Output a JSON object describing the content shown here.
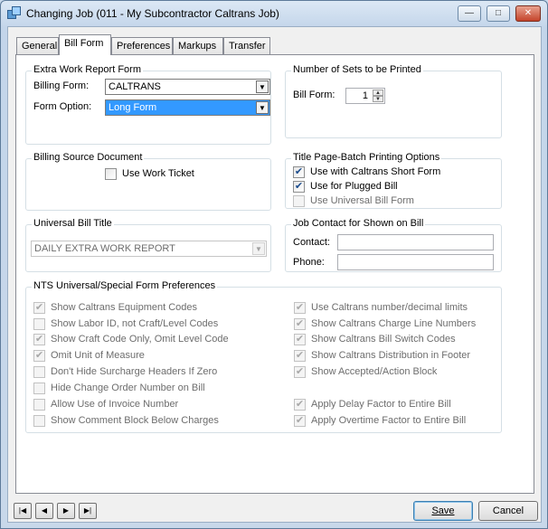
{
  "window": {
    "title": "Changing Job  (011 - My Subcontractor Caltrans Job)",
    "controls": {
      "minimize": "—",
      "maximize": "□",
      "close": "✕"
    }
  },
  "tabs": [
    {
      "label": "General"
    },
    {
      "label": "Bill Form",
      "active": true
    },
    {
      "label": "Preferences"
    },
    {
      "label": "Markups"
    },
    {
      "label": "Transfer"
    }
  ],
  "extra_work": {
    "title": "Extra Work Report Form",
    "billing_form_label": "Billing Form:",
    "billing_form_value": "CALTRANS",
    "form_option_label": "Form Option:",
    "form_option_value": "Long Form"
  },
  "sets_printed": {
    "title": "Number of Sets to be Printed",
    "bill_form_label": "Bill Form:",
    "bill_form_value": "1"
  },
  "billing_source": {
    "title": "Billing Source Document",
    "use_work_ticket": {
      "label": "Use Work Ticket",
      "checked": false
    }
  },
  "title_page": {
    "title": "Title Page-Batch Printing Options",
    "options": [
      {
        "label": "Use with Caltrans Short Form",
        "checked": true,
        "enabled": true
      },
      {
        "label": "Use for Plugged Bill",
        "checked": true,
        "enabled": true
      },
      {
        "label": "Use Universal Bill Form",
        "checked": false,
        "enabled": false
      }
    ]
  },
  "universal_title": {
    "title": "Universal Bill Title",
    "value": "DAILY EXTRA WORK REPORT"
  },
  "job_contact": {
    "title": "Job Contact for Shown on Bill",
    "contact_label": "Contact:",
    "contact_value": "",
    "phone_label": "Phone:",
    "phone_value": ""
  },
  "nts_prefs": {
    "title": "NTS Universal/Special Form Preferences",
    "left": [
      {
        "label": "Show Caltrans Equipment Codes",
        "checked": true
      },
      {
        "label": "Show Labor ID, not Craft/Level Codes",
        "checked": false
      },
      {
        "label": "Show Craft Code Only, Omit Level Code",
        "checked": true
      },
      {
        "label": "Omit Unit of Measure",
        "checked": true
      },
      {
        "label": "Don't Hide Surcharge Headers If Zero",
        "checked": false
      },
      {
        "label": "Hide Change Order Number on Bill",
        "checked": false
      },
      {
        "label": "Allow Use of Invoice Number",
        "checked": false
      },
      {
        "label": "Show Comment Block Below Charges",
        "checked": false
      }
    ],
    "right": [
      {
        "label": "Use Caltrans number/decimal limits",
        "checked": true
      },
      {
        "label": "Show Caltrans Charge Line Numbers",
        "checked": true
      },
      {
        "label": "Show Caltrans Bill Switch Codes",
        "checked": true
      },
      {
        "label": "Show Caltrans Distribution in Footer",
        "checked": true
      },
      {
        "label": "Show Accepted/Action Block",
        "checked": true
      },
      {
        "label": "Apply Delay Factor to Entire Bill",
        "checked": true
      },
      {
        "label": "Apply Overtime Factor to Entire Bill",
        "checked": true
      }
    ]
  },
  "nav": {
    "first": "|◀",
    "prev": "◀",
    "next": "▶",
    "last": "▶|"
  },
  "buttons": {
    "save": "Save",
    "cancel": "Cancel"
  }
}
